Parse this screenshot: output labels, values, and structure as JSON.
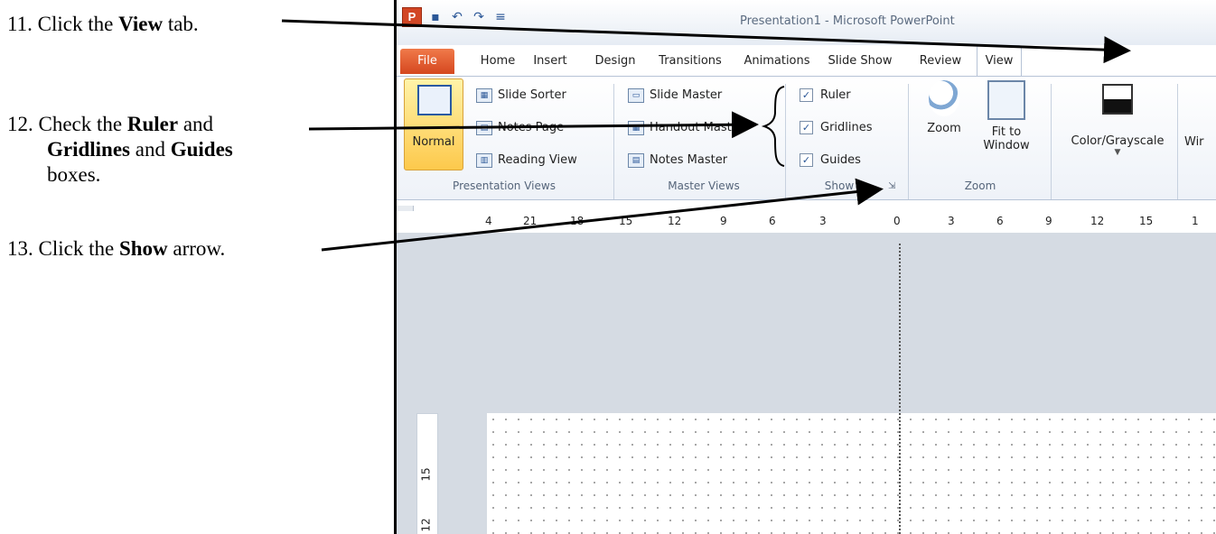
{
  "instructions": {
    "step11": {
      "num": "11.",
      "pre": "Click the",
      "bold": "View",
      "post": "tab."
    },
    "step12": {
      "num": "12.",
      "pre": "Check the",
      "bold1": "Ruler",
      "mid1": "and",
      "bold2": "Gridlines",
      "mid2": "and",
      "bold3": "Guides",
      "post": "boxes."
    },
    "step13": {
      "num": "13.",
      "pre": "Click the",
      "bold": "Show",
      "post": "arrow."
    }
  },
  "window": {
    "title": "Presentation1  -  Microsoft PowerPoint",
    "tabs": [
      "File",
      "Home",
      "Insert",
      "Design",
      "Transitions",
      "Animations",
      "Slide Show",
      "Review",
      "View"
    ],
    "active_tab": "View"
  },
  "ribbon": {
    "presentation_views": {
      "label": "Presentation Views",
      "normal": "Normal",
      "items": [
        "Slide Sorter",
        "Notes Page",
        "Reading View"
      ]
    },
    "master_views": {
      "label": "Master Views",
      "items": [
        "Slide Master",
        "Handout Master",
        "Notes Master"
      ]
    },
    "show": {
      "label": "Show",
      "checkboxes": [
        {
          "label": "Ruler",
          "checked": true
        },
        {
          "label": "Gridlines",
          "checked": true
        },
        {
          "label": "Guides",
          "checked": true
        }
      ]
    },
    "zoom": {
      "label": "Zoom",
      "zoom_btn": "Zoom",
      "fit_line1": "Fit to",
      "fit_line2": "Window"
    },
    "color": {
      "label": "Color/Grayscale"
    },
    "window_partial": "Wir"
  },
  "ruler": {
    "h_ticks": [
      "4",
      "21",
      "18",
      "15",
      "12",
      "9",
      "6",
      "3",
      "0",
      "3",
      "6",
      "9",
      "12",
      "15",
      "1"
    ],
    "v_ticks": [
      "15",
      "12"
    ]
  },
  "colors": {
    "file_tab": "#d5471f",
    "normal_btn": "#fdc94c",
    "workspace": "#d5dbe3"
  }
}
